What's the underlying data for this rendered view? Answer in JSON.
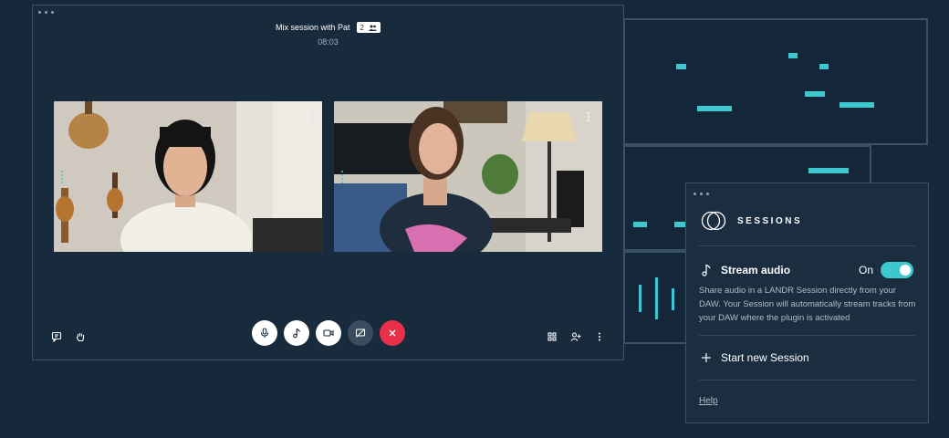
{
  "call": {
    "title": "Mix session with Pat",
    "participant_count": "2",
    "timer": "08:03",
    "controls": [
      {
        "name": "microphone",
        "icon": "mic-icon"
      },
      {
        "name": "music-note",
        "icon": "music-note-icon"
      },
      {
        "name": "camera",
        "icon": "video-camera-icon"
      },
      {
        "name": "screen-share-off",
        "icon": "screen-share-off-icon"
      },
      {
        "name": "end-call",
        "icon": "close-icon"
      }
    ],
    "left_tools": [
      "chat-icon",
      "raise-hand-icon"
    ],
    "right_tools": [
      "grid-view-icon",
      "add-person-icon",
      "more-vertical-icon"
    ]
  },
  "sessions": {
    "brand": "SESSIONS",
    "stream_audio_label": "Stream audio",
    "stream_audio_state": "On",
    "stream_audio_enabled": true,
    "stream_audio_description": "Share audio in a LANDR Session directly from your DAW. Your Session will automatically stream tracks from your DAW where the plugin is activated",
    "start_new_label": "Start new Session",
    "help_label": "Help"
  },
  "colors": {
    "background": "#15283a",
    "accent": "#3ec7cf",
    "end_call": "#e8304a",
    "panel": "#1b2e40"
  }
}
